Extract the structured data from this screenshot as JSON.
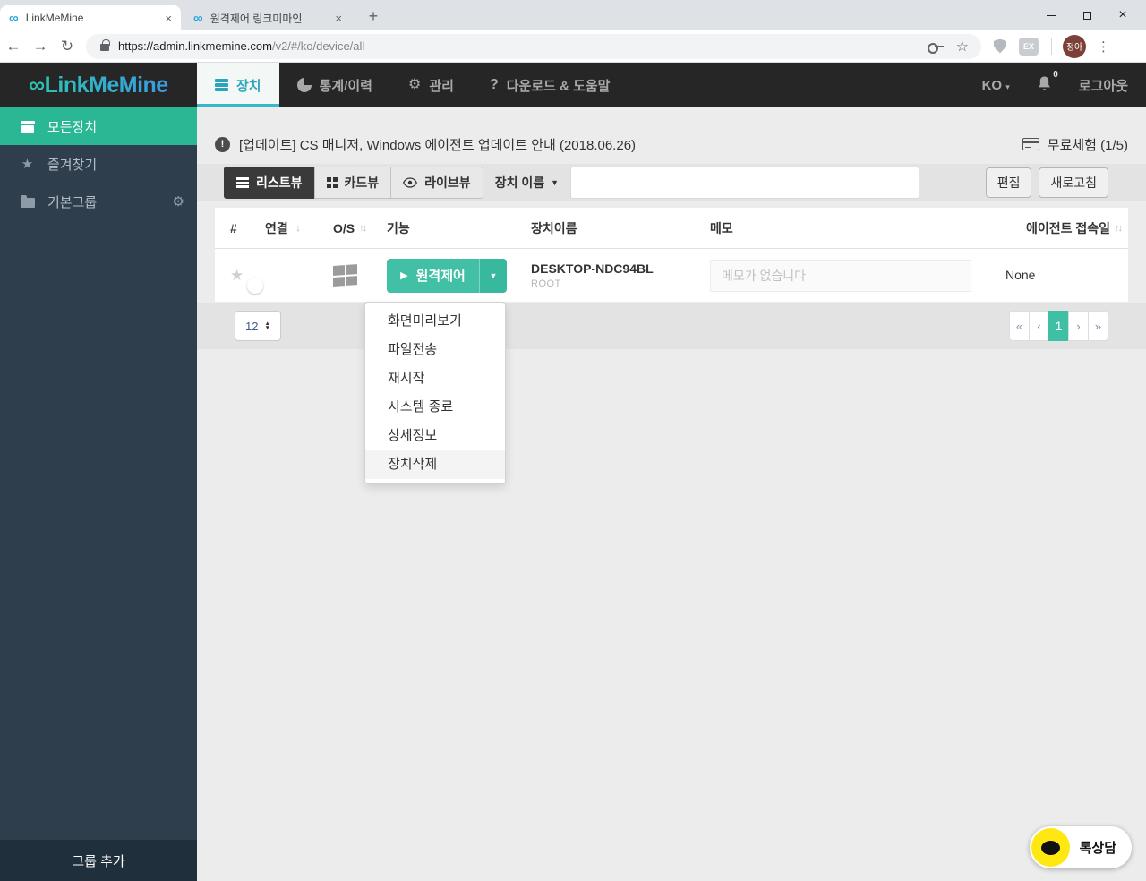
{
  "browser": {
    "tabs": [
      {
        "title": "LinkMeMine"
      },
      {
        "title": "원격제어 링크미마인"
      }
    ],
    "url_domain": "https://admin.linkmemine.com",
    "url_path": "/v2/#/ko/device/all",
    "extension_badge": "EX",
    "profile_name": "정아"
  },
  "topnav": {
    "logo_mark": "∞",
    "logo_text": "LinkMeMine",
    "items": [
      {
        "label": "장치"
      },
      {
        "label": "통계/이력"
      },
      {
        "label": "관리"
      },
      {
        "label": "다운로드 & 도움말"
      }
    ],
    "language": "KO",
    "notification_count": "0",
    "logout_label": "로그아웃"
  },
  "sidebar": {
    "items": [
      {
        "label": "모든장치"
      },
      {
        "label": "즐겨찾기"
      },
      {
        "label": "기본그룹"
      }
    ],
    "add_group_label": "그룹 추가"
  },
  "content": {
    "announcement": "[업데이트] CS 매니저, Windows 에이전트 업데이트 안내 (2018.06.26)",
    "trial_label": "무료체험 (1/5)",
    "toolbar": {
      "list_view": "리스트뷰",
      "card_view": "카드뷰",
      "live_view": "라이브뷰",
      "filter_label": "장치 이름",
      "search_value": "",
      "edit": "편집",
      "refresh": "새로고침"
    },
    "table": {
      "headers": [
        "#",
        "연결",
        "O/S",
        "기능",
        "장치이름",
        "메모",
        "에이전트 접속일"
      ],
      "row": {
        "remote_control": "원격제어",
        "device_name": "DESKTOP-NDC94BL",
        "device_owner": "ROOT",
        "memo_placeholder": "메모가 없습니다",
        "agent_date": "None"
      }
    },
    "dropdown_items": [
      "화면미리보기",
      "파일전송",
      "재시작",
      "시스템 종료",
      "상세정보",
      "장치삭제"
    ],
    "page_size": "12",
    "pagination": {
      "first": "«",
      "prev": "‹",
      "page": "1",
      "next": "›",
      "last": "»"
    }
  },
  "chat_label": "톡상담",
  "colors": {
    "accent_green": "#2ab793",
    "accent_cyan": "#35b8c9",
    "button_teal": "#41c0a5",
    "toggle_green": "#53cf5d",
    "kakao_yellow": "#ffe812",
    "nav_dark": "#262626",
    "sidebar_dark": "#2f3e4d"
  }
}
